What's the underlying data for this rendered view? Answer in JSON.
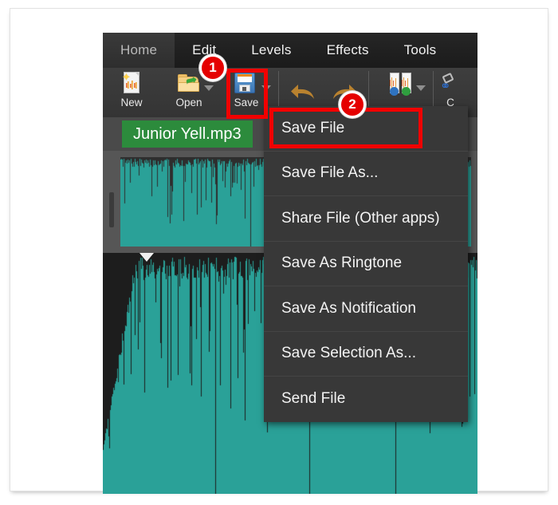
{
  "app": {
    "tabs": [
      {
        "label": "Home",
        "active": true
      },
      {
        "label": "Edit",
        "active": false
      },
      {
        "label": "Levels",
        "active": false
      },
      {
        "label": "Effects",
        "active": false
      },
      {
        "label": "Tools",
        "active": false
      }
    ],
    "toolbar": {
      "items": [
        {
          "label": "New",
          "icon": "new-file-icon",
          "has_caret": false
        },
        {
          "label": "Open",
          "icon": "open-folder-icon",
          "has_caret": true
        },
        {
          "label": "Save",
          "icon": "floppy-disk-icon",
          "has_caret": true
        }
      ],
      "undo_icon": "undo-arrow-icon",
      "redo_icon": "redo-arrow-icon",
      "levels_icon": "amplify-levels-icon",
      "levels_has_caret": true,
      "clipped_label": "C",
      "clipped_icon": "cut-icon"
    },
    "file": {
      "name": "Junior Yell.mp3",
      "chip_color": "#2c8b3c"
    },
    "waveform": {
      "color": "#2aa198",
      "overview_background": "#2e2e2e",
      "main_background": "#1d1d1d",
      "playhead_icon": "playhead-marker-icon"
    }
  },
  "menu": {
    "items": [
      {
        "label": "Save File"
      },
      {
        "label": "Save File As..."
      },
      {
        "label": "Share File (Other apps)"
      },
      {
        "label": "Save As Ringtone"
      },
      {
        "label": "Save As Notification"
      },
      {
        "label": "Save Selection As..."
      },
      {
        "label": "Send File"
      }
    ]
  },
  "annotations": {
    "color": "#f20000",
    "badges": [
      {
        "number": "1",
        "target": "save-toolbar-button"
      },
      {
        "number": "2",
        "target": "menu-item-save-file"
      }
    ]
  }
}
